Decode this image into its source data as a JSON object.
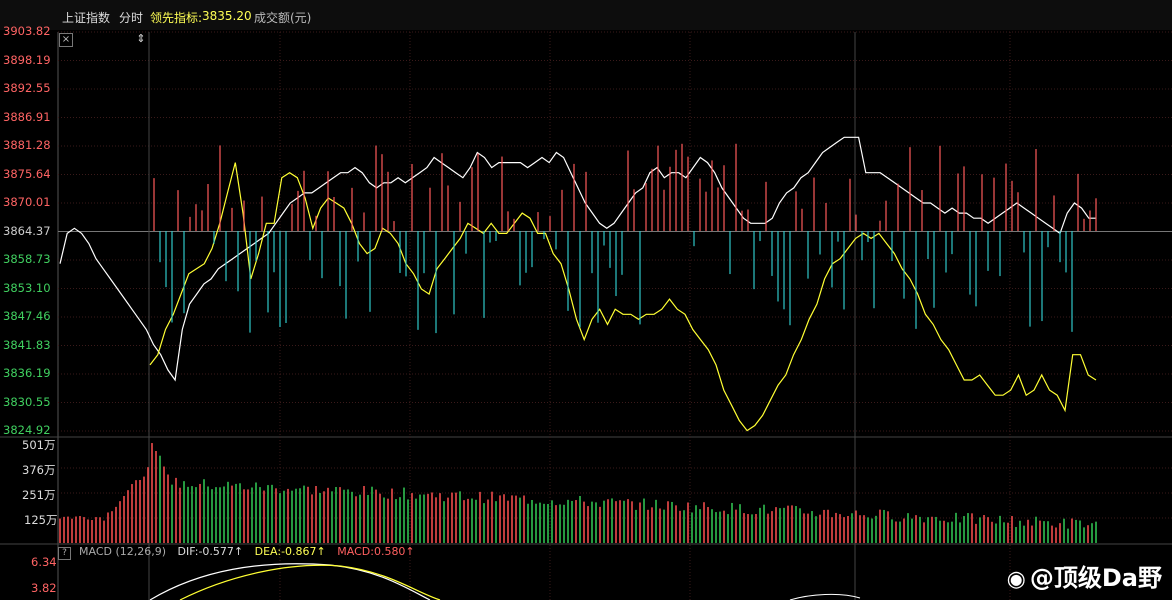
{
  "header": {
    "index_name": "上证指数",
    "period": "分时",
    "leader_label": "领先指标:",
    "leader_value": "3835.20",
    "volume_label": "成交额(元)"
  },
  "colors": {
    "up": "#ff5a5a",
    "down": "#2ec7c9",
    "price_line": "#ffffff",
    "leader_line": "#ffff33",
    "grid": "#3a1a1a",
    "vol_up": "#ff5050",
    "vol_down": "#33cc55"
  },
  "price_axis": {
    "ticks_up": [
      "3903.82",
      "3898.19",
      "3892.55",
      "3886.91",
      "3881.28",
      "3875.64",
      "3870.01"
    ],
    "tick_mid": "3864.37",
    "ticks_down": [
      "3858.73",
      "3853.10",
      "3847.46",
      "3841.83",
      "3836.19",
      "3830.55",
      "3824.92"
    ]
  },
  "volume_axis": {
    "ticks": [
      "501万",
      "376万",
      "251万",
      "125万"
    ]
  },
  "macd": {
    "help": "?",
    "name": "MACD (12,26,9)",
    "dif": "DIF:-0.577↑",
    "dea": "DEA:-0.867↑",
    "macd": "MACD:0.580↑",
    "ticks": [
      "6.34",
      "3.82"
    ]
  },
  "chart_data": {
    "type": "line",
    "title": "",
    "ylim": [
      3824.92,
      3903.82
    ],
    "prev_close": 3864.37,
    "series": [
      {
        "name": "",
        "values": [
          3858,
          3864,
          3865,
          3864,
          3862,
          3859,
          3857,
          3855,
          3853,
          3851,
          3849,
          3847,
          3845,
          3842,
          3840,
          3837,
          3835,
          3845,
          3850,
          3852,
          3854,
          3855,
          3857,
          3858,
          3859,
          3860,
          3861,
          3862,
          3863,
          3864,
          3866,
          3868,
          3870,
          3871,
          3872,
          3872,
          3873,
          3874,
          3875,
          3876,
          3876,
          3877,
          3876,
          3874,
          3873,
          3874,
          3874,
          3875,
          3874,
          3875,
          3876,
          3877,
          3879,
          3878,
          3877,
          3876,
          3875,
          3877,
          3880,
          3879,
          3877,
          3878,
          3878,
          3878,
          3878,
          3877,
          3878,
          3879,
          3878,
          3880,
          3879,
          3876,
          3873,
          3870,
          3868,
          3866,
          3865,
          3866,
          3868,
          3870,
          3872,
          3873,
          3876,
          3877,
          3875,
          3876,
          3876,
          3875,
          3877,
          3879,
          3878,
          3876,
          3873,
          3871,
          3869,
          3867,
          3866,
          3866,
          3866,
          3867,
          3870,
          3872,
          3873,
          3875,
          3876,
          3878,
          3880,
          3881,
          3882,
          3883,
          3883,
          3883,
          3876,
          3876,
          3876,
          3875,
          3874,
          3873,
          3872,
          3871,
          3870,
          3870,
          3869,
          3868,
          3869,
          3868,
          3868,
          3867,
          3867,
          3866,
          3867,
          3868,
          3869,
          3870,
          3869,
          3868,
          3867,
          3866,
          3865,
          3864,
          3868,
          3870,
          3869,
          3867,
          3867
        ]
      },
      {
        "name": "",
        "values": [
          3838,
          3840,
          3845,
          3848,
          3852,
          3856,
          3857,
          3858,
          3861,
          3866,
          3872,
          3878,
          3868,
          3855,
          3860,
          3866,
          3866,
          3875,
          3876,
          3875,
          3871,
          3865,
          3869,
          3871,
          3870,
          3869,
          3866,
          3862,
          3860,
          3861,
          3865,
          3864,
          3862,
          3858,
          3856,
          3853,
          3852,
          3857,
          3859,
          3861,
          3863,
          3866,
          3865,
          3864,
          3866,
          3864,
          3864,
          3866,
          3868,
          3867,
          3864,
          3864,
          3860,
          3858,
          3853,
          3847,
          3843,
          3847,
          3849,
          3846,
          3849,
          3848,
          3848,
          3847,
          3848,
          3848,
          3849,
          3851,
          3849,
          3848,
          3845,
          3843,
          3841,
          3838,
          3833,
          3830,
          3827,
          3825,
          3826,
          3828,
          3831,
          3834,
          3836,
          3840,
          3843,
          3847,
          3850,
          3855,
          3858,
          3859,
          3861,
          3863,
          3864,
          3863,
          3864,
          3862,
          3860,
          3857,
          3855,
          3852,
          3848,
          3846,
          3843,
          3841,
          3838,
          3835,
          3835,
          3836,
          3834,
          3832,
          3832,
          3833,
          3836,
          3832,
          3833,
          3836,
          3833,
          3832,
          3829,
          3840,
          3840,
          3836,
          3835
        ]
      }
    ]
  }
}
